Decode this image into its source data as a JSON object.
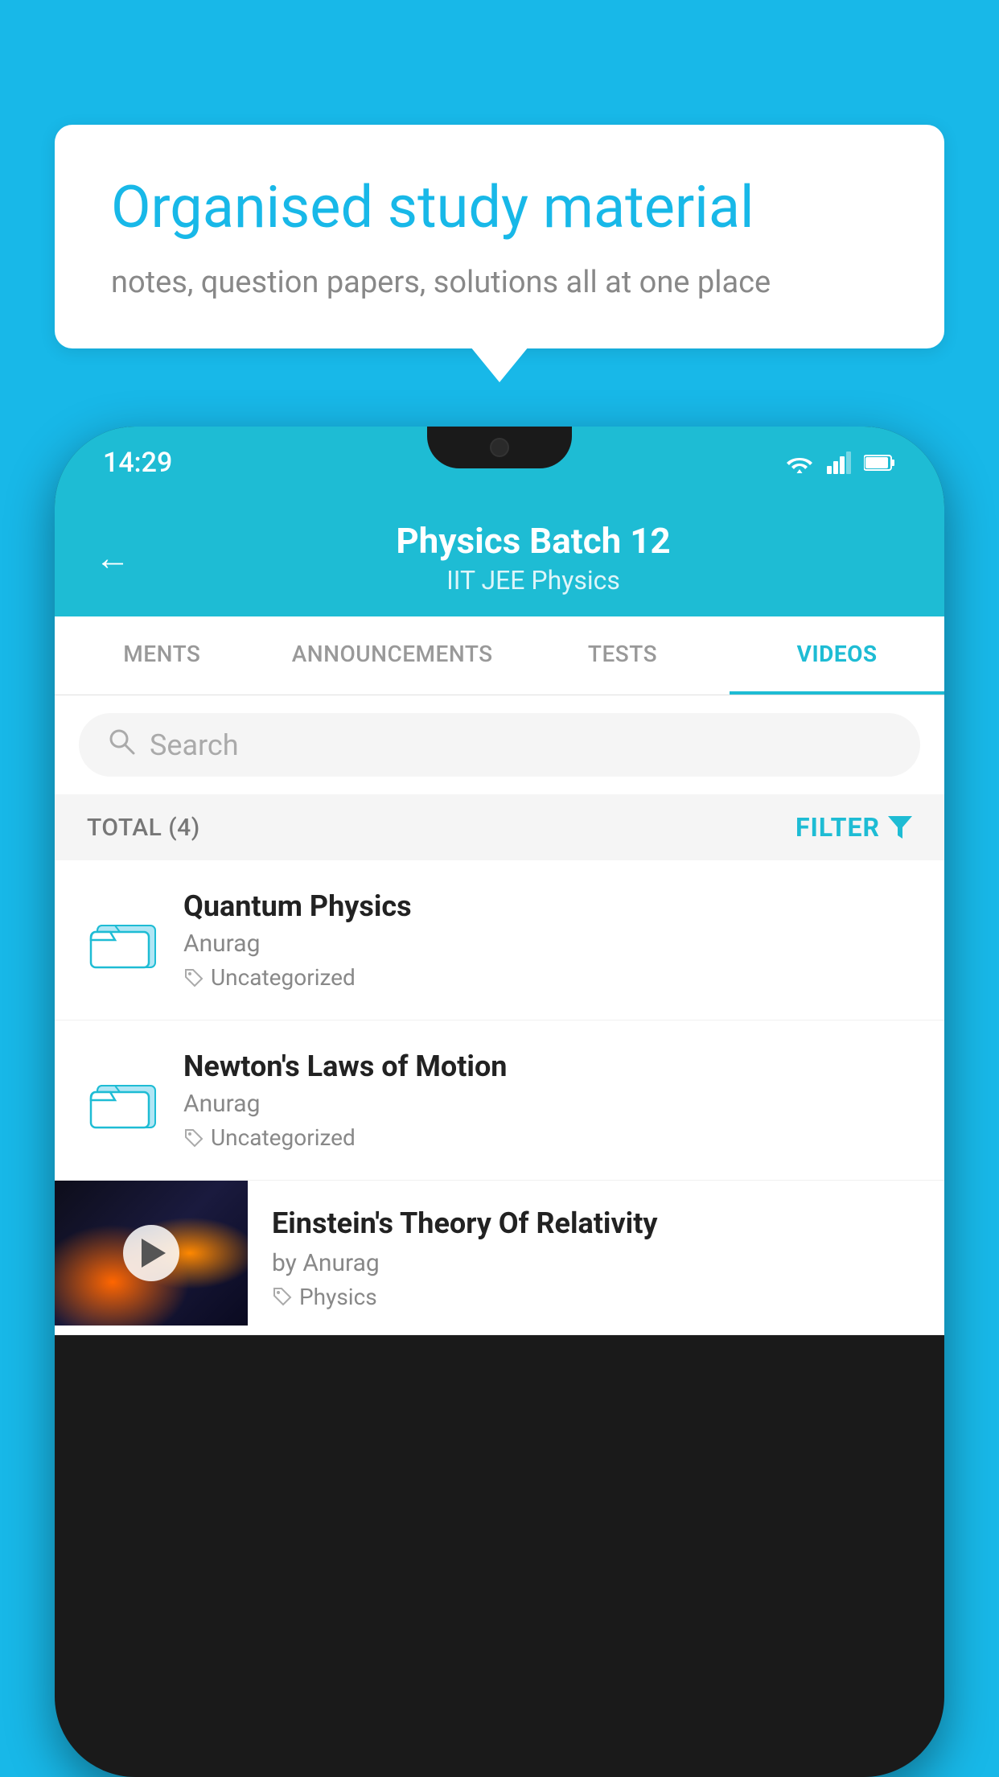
{
  "page": {
    "background_color": "#18b8e8"
  },
  "speech_bubble": {
    "title": "Organised study material",
    "subtitle": "notes, question papers, solutions all at one place"
  },
  "phone": {
    "status_bar": {
      "time": "14:29"
    },
    "header": {
      "title": "Physics Batch 12",
      "subtitle": "IIT JEE    Physics",
      "back_label": "←"
    },
    "tabs": [
      {
        "label": "MENTS",
        "active": false
      },
      {
        "label": "ANNOUNCEMENTS",
        "active": false
      },
      {
        "label": "TESTS",
        "active": false
      },
      {
        "label": "VIDEOS",
        "active": true
      }
    ],
    "search": {
      "placeholder": "Search"
    },
    "filter_bar": {
      "total_label": "TOTAL (4)",
      "filter_label": "FILTER"
    },
    "videos": [
      {
        "title": "Quantum Physics",
        "author": "Anurag",
        "tag": "Uncategorized",
        "has_thumbnail": false
      },
      {
        "title": "Newton's Laws of Motion",
        "author": "Anurag",
        "tag": "Uncategorized",
        "has_thumbnail": false
      },
      {
        "title": "Einstein's Theory Of Relativity",
        "author": "by Anurag",
        "tag": "Physics",
        "has_thumbnail": true
      }
    ]
  }
}
